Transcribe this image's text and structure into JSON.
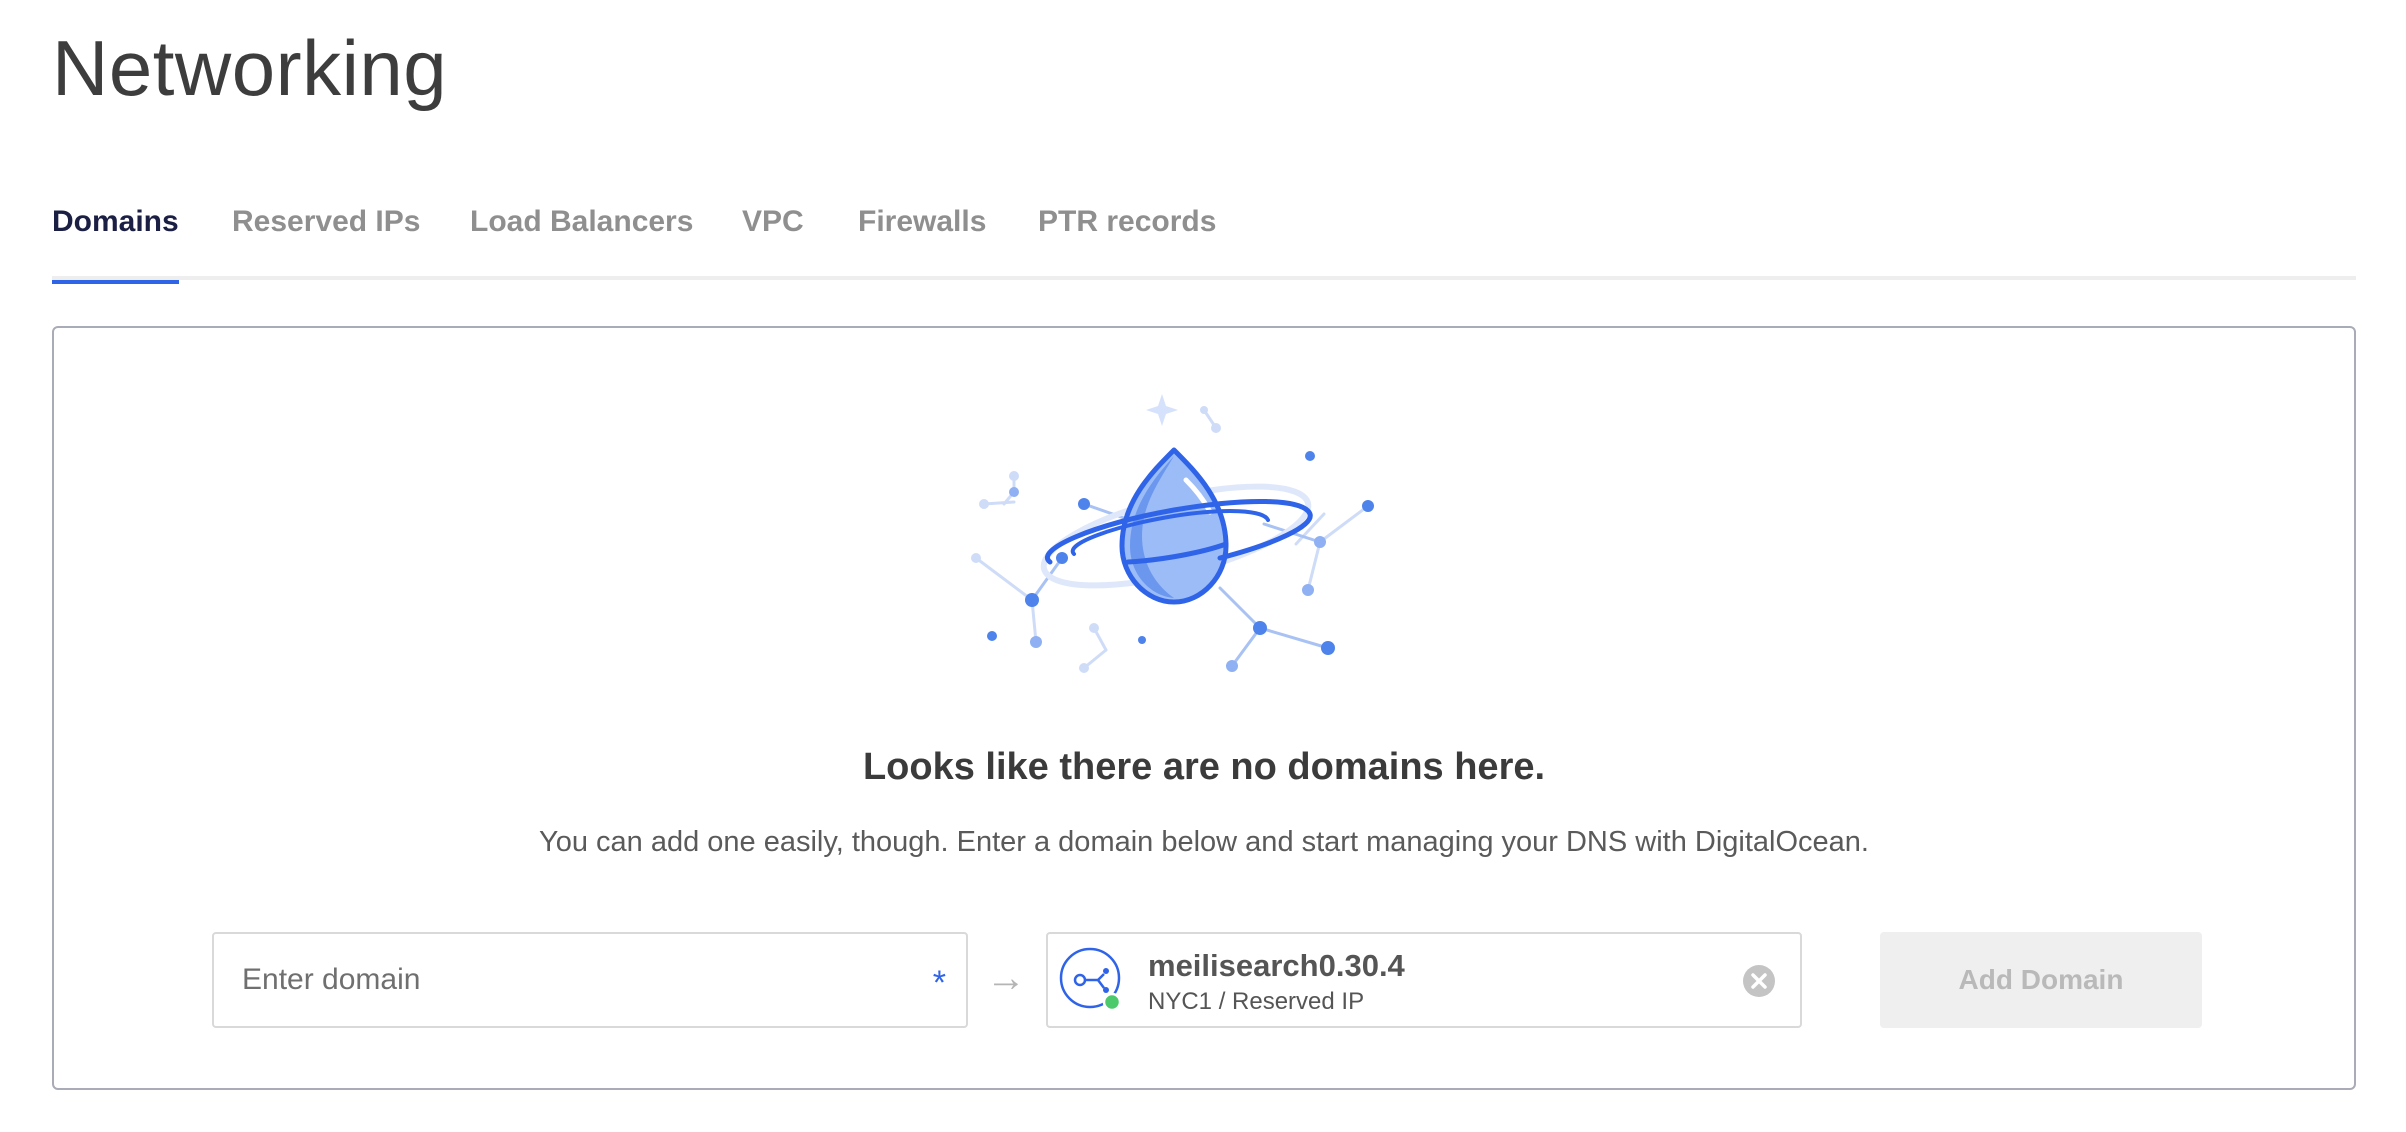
{
  "page": {
    "title": "Networking"
  },
  "tabs": [
    {
      "label": "Domains",
      "active": true
    },
    {
      "label": "Reserved IPs",
      "active": false
    },
    {
      "label": "Load Balancers",
      "active": false
    },
    {
      "label": "VPC",
      "active": false
    },
    {
      "label": "Firewalls",
      "active": false
    },
    {
      "label": "PTR records",
      "active": false
    }
  ],
  "empty_state": {
    "heading": "Looks like there are no domains here.",
    "description": "You can add one easily, though. Enter a domain below and start managing your DNS with DigitalOcean.",
    "illustration_icon": "droplet-planet-icon"
  },
  "form": {
    "domain_placeholder": "Enter domain",
    "domain_value": "",
    "required_mark": "*",
    "arrow": "→",
    "resource": {
      "name": "meilisearch0.30.4",
      "meta": "NYC1 / Reserved IP",
      "icon": "reserved-ip-icon",
      "status": "active"
    },
    "add_button_label": "Add Domain",
    "add_button_disabled": true
  },
  "colors": {
    "accent": "#2f64e8",
    "active_tab_text": "#1b1f44",
    "inactive_tab_text": "#8f8f8f",
    "status_green": "#4cc96a",
    "disabled_button_bg": "#efefef",
    "disabled_button_text": "#b9b9b9"
  }
}
